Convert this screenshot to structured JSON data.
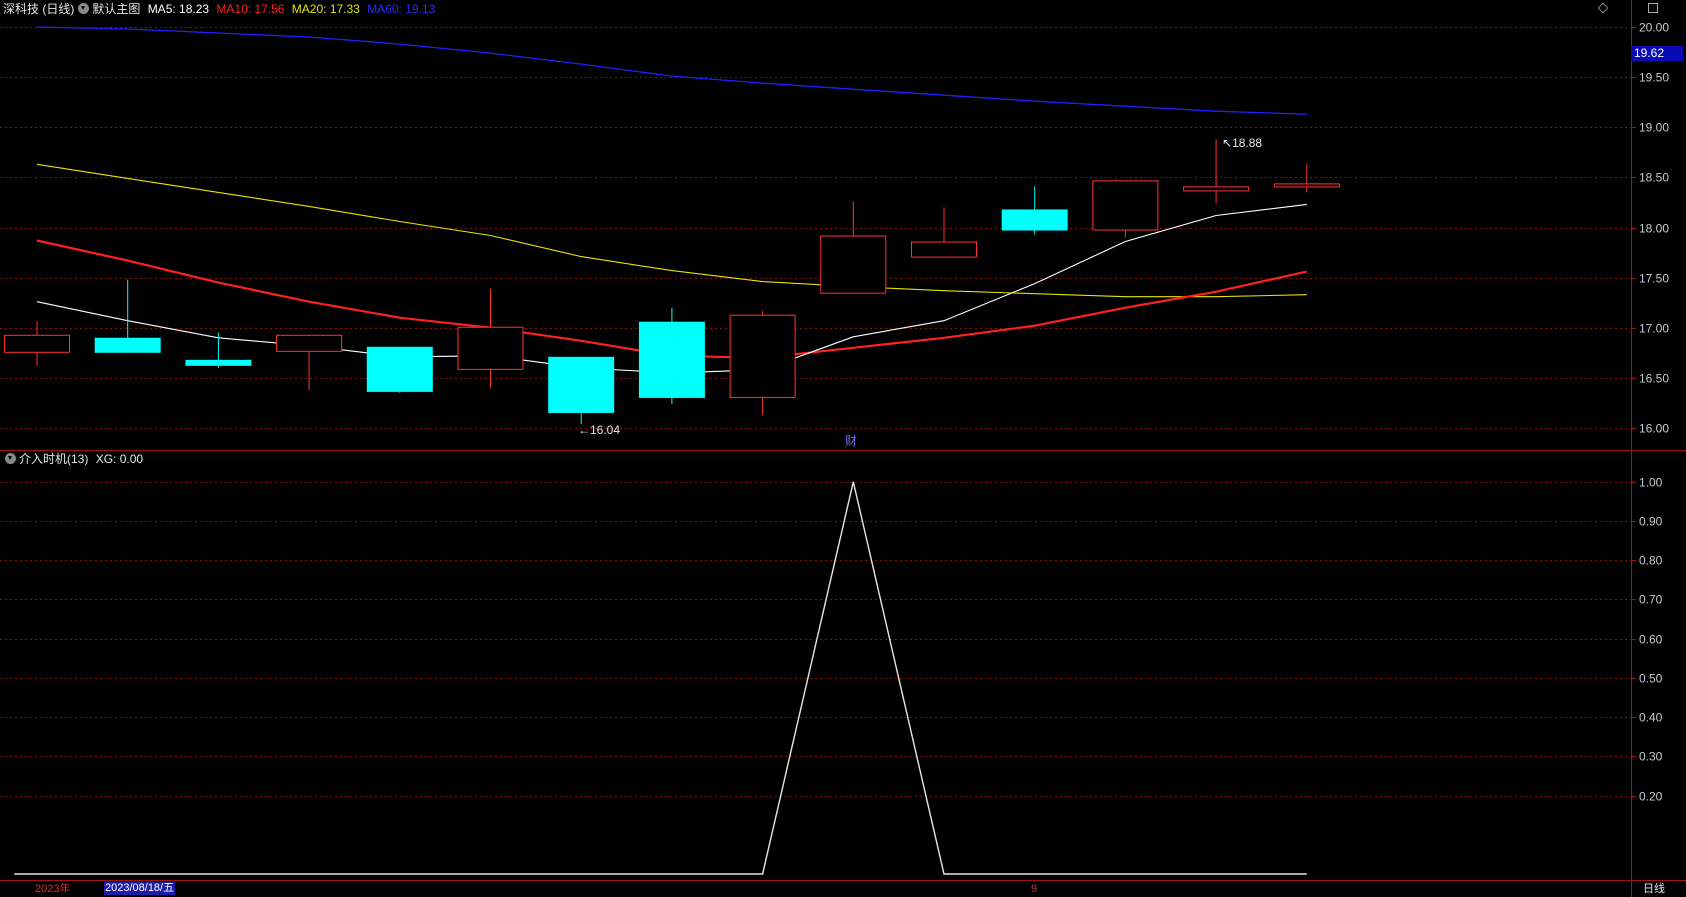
{
  "header": {
    "stock": "深科技 (日线)",
    "template": "默认主图",
    "ma5": "MA5: 18.23",
    "ma10": "MA10: 17.56",
    "ma20": "MA20: 17.33",
    "ma60": "MA60: 19.13"
  },
  "sub_header": {
    "indicator": "介入时机(13)",
    "xg": "XG: 0.00"
  },
  "last_price_tag": "19.62",
  "colors": {
    "up": "#ff3232",
    "down": "#00ffff",
    "ma5": "#ffffff",
    "ma10": "#ff2020",
    "ma20": "#e6e600",
    "ma60": "#2020ff",
    "grid": "#8c1010",
    "axis_text": "#c8c8c8"
  },
  "bottom_bar": {
    "year": "2023年",
    "date": "2023/08/18/五",
    "month": "9",
    "period": "日线"
  },
  "annotations": {
    "high_label": "18.88",
    "low_label": "16.04",
    "fin_marker": "财"
  },
  "chart_data": [
    {
      "type": "candlestick",
      "ylim": [
        15.95,
        20.05
      ],
      "yticks": [
        "20.00",
        "19.50",
        "19.00",
        "18.50",
        "18.00",
        "17.50",
        "17.00",
        "16.50",
        "16.00"
      ],
      "candles": [
        {
          "open": 16.75,
          "close": 16.93,
          "high": 17.07,
          "low": 16.62
        },
        {
          "open": 16.9,
          "close": 16.75,
          "high": 17.48,
          "low": 16.75
        },
        {
          "open": 16.68,
          "close": 16.62,
          "high": 16.95,
          "low": 16.6
        },
        {
          "open": 16.76,
          "close": 16.93,
          "high": 16.93,
          "low": 16.38
        },
        {
          "open": 16.81,
          "close": 16.36,
          "high": 16.81,
          "low": 16.35
        },
        {
          "open": 16.58,
          "close": 17.01,
          "high": 17.39,
          "low": 16.4
        },
        {
          "open": 16.71,
          "close": 16.15,
          "high": 16.71,
          "low": 16.04
        },
        {
          "open": 17.06,
          "close": 16.3,
          "high": 17.2,
          "low": 16.24
        },
        {
          "open": 16.3,
          "close": 17.13,
          "high": 17.17,
          "low": 16.13
        },
        {
          "open": 17.34,
          "close": 17.92,
          "high": 18.26,
          "low": 17.34
        },
        {
          "open": 17.7,
          "close": 17.86,
          "high": 18.2,
          "low": 17.7
        },
        {
          "open": 18.18,
          "close": 17.97,
          "high": 18.41,
          "low": 17.93
        },
        {
          "open": 17.97,
          "close": 18.47,
          "high": 18.47,
          "low": 17.9
        },
        {
          "open": 18.36,
          "close": 18.41,
          "high": 18.88,
          "low": 18.24
        },
        {
          "open": 18.4,
          "close": 18.44,
          "high": 18.64,
          "low": 18.35
        }
      ],
      "ma5": [
        17.26,
        17.07,
        16.9,
        16.82,
        16.71,
        16.72,
        16.6,
        16.55,
        16.58,
        16.91,
        17.07,
        17.44,
        17.86,
        18.12,
        18.23
      ],
      "ma10": [
        17.87,
        17.67,
        17.45,
        17.26,
        17.1,
        17.0,
        16.87,
        16.72,
        16.7,
        16.8,
        16.9,
        17.02,
        17.2,
        17.36,
        17.56
      ],
      "ma20": [
        18.63,
        18.49,
        18.35,
        18.21,
        18.06,
        17.92,
        17.71,
        17.57,
        17.46,
        17.41,
        17.37,
        17.34,
        17.31,
        17.31,
        17.33
      ],
      "ma60": [
        20.0,
        19.98,
        19.94,
        19.9,
        19.83,
        19.74,
        19.63,
        19.51,
        19.44,
        19.38,
        19.32,
        19.26,
        19.21,
        19.16,
        19.13
      ]
    },
    {
      "type": "line",
      "ylim": [
        0.0,
        1.03
      ],
      "yticks": [
        "1.00",
        "0.90",
        "0.80",
        "0.70",
        "0.60",
        "0.50",
        "0.40",
        "0.30",
        "0.20"
      ],
      "x_start": -0.25,
      "values": [
        0,
        0,
        0,
        0,
        0,
        0,
        0,
        0,
        0,
        1,
        0,
        0,
        0,
        0,
        0
      ]
    }
  ]
}
